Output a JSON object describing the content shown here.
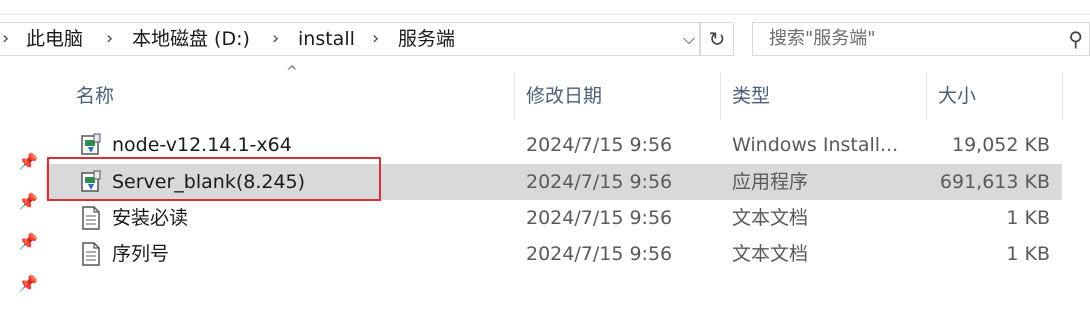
{
  "address_bar": {
    "breadcrumbs": [
      "此电脑",
      "本地磁盘 (D:)",
      "install",
      "服务端"
    ],
    "separator": "›",
    "dropdown": "⌵"
  },
  "refresh_icon": "↻",
  "search": {
    "placeholder": "搜索\"服务端\"",
    "icon": "⚲"
  },
  "columns": [
    "名称",
    "修改日期",
    "类型",
    "大小"
  ],
  "sort_indicator": "^",
  "files": [
    {
      "name": "node-v12.14.1-x64",
      "date": "2024/7/15 9:56",
      "type": "Windows Install...",
      "size": "19,052 KB",
      "icon": "installer-icon"
    },
    {
      "name": "Server_blank(8.245)",
      "date": "2024/7/15 9:56",
      "type": "应用程序",
      "size": "691,613 KB",
      "icon": "installer-icon",
      "selected": true
    },
    {
      "name": "安装必读",
      "date": "2024/7/15 9:56",
      "type": "文本文档",
      "size": "1 KB",
      "icon": "text-file-icon"
    },
    {
      "name": "序列号",
      "date": "2024/7/15 9:56",
      "type": "文本文档",
      "size": "1 KB",
      "icon": "text-file-icon"
    }
  ],
  "pin_glyph": "📌",
  "colors": {
    "selection": "#d9d9d9",
    "highlight_box": "#d8303a",
    "header_text": "#4c607a"
  }
}
